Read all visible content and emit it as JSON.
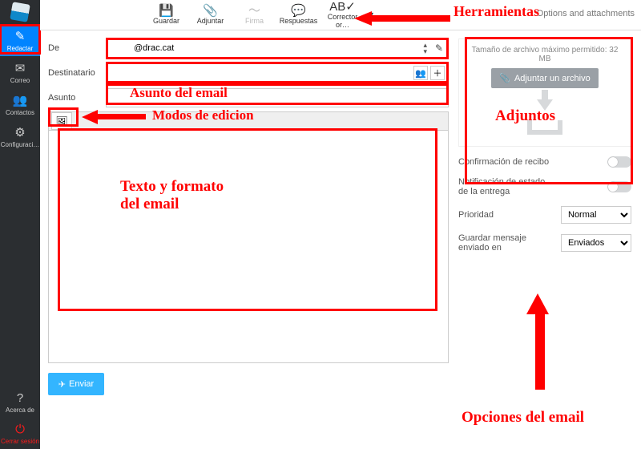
{
  "sidebar": {
    "items": [
      {
        "label": "Redactar",
        "icon": "✎"
      },
      {
        "label": "Correo",
        "icon": "✉"
      },
      {
        "label": "Contactos",
        "icon": "👥"
      },
      {
        "label": "Configuraci…",
        "icon": "⚙"
      }
    ],
    "help": {
      "label": "Acerca de",
      "icon": "?"
    },
    "logout": {
      "label": "Cerrar sesión",
      "icon": "⏻"
    }
  },
  "toolbar": {
    "save": "Guardar",
    "attach": "Adjuntar",
    "sign": "Firma",
    "responses": "Respuestas",
    "spell": "Corrector or…",
    "opt_label": "Options and attachments"
  },
  "compose": {
    "from_label": "De",
    "from_value": "@drac.cat",
    "to_label": "Destinatario",
    "subject_label": "Asunto",
    "send": "Enviar"
  },
  "options": {
    "max": "Tamaño de archivo máximo permitido: 32 MB",
    "attach_btn": "Adjuntar un archivo",
    "receipt": "Confirmación de recibo",
    "dsn": "Notificación de estado de la entrega",
    "priority": "Prioridad",
    "priority_val": "Normal",
    "savein": "Guardar mensaje enviado en",
    "savein_val": "Enviados"
  },
  "annotations": {
    "tools": "Herramientas",
    "subject": "Asunto del email",
    "modes": "Modos de edicion",
    "body": "Texto y formato\ndel email",
    "attach": "Adjuntos",
    "opts": "Opciones del email"
  }
}
